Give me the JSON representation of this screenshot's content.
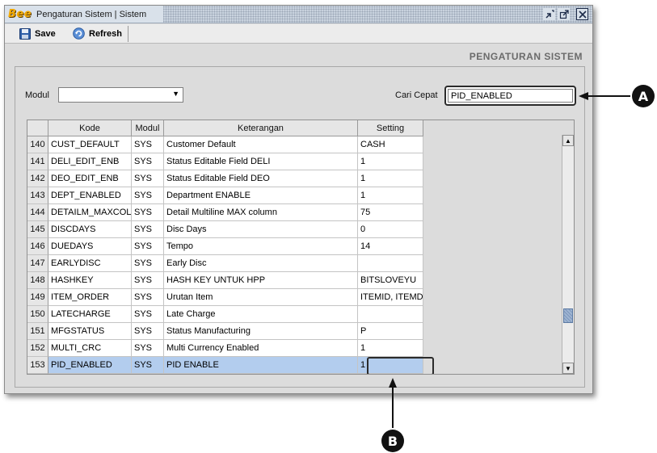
{
  "window": {
    "logo": "Bee",
    "title": "Pengaturan Sistem | Sistem"
  },
  "toolbar": {
    "save_label": "Save",
    "refresh_label": "Refresh"
  },
  "page_title": "PENGATURAN SISTEM",
  "filters": {
    "modul_label": "Modul",
    "modul_value": "",
    "search_label": "Cari Cepat",
    "search_value": "PID_ENABLED"
  },
  "grid": {
    "columns": [
      "Kode",
      "Modul",
      "Keterangan",
      "Setting"
    ],
    "rows": [
      {
        "no": "140",
        "kode": "CUST_DEFAULT",
        "modul": "SYS",
        "ket": "Customer Default",
        "set": "CASH"
      },
      {
        "no": "141",
        "kode": "DELI_EDIT_ENB",
        "modul": "SYS",
        "ket": "Status Editable Field DELI",
        "set": "1"
      },
      {
        "no": "142",
        "kode": "DEO_EDIT_ENB",
        "modul": "SYS",
        "ket": "Status Editable Field DEO",
        "set": "1"
      },
      {
        "no": "143",
        "kode": "DEPT_ENABLED",
        "modul": "SYS",
        "ket": "Department ENABLE",
        "set": "1"
      },
      {
        "no": "144",
        "kode": "DETAILM_MAXCOL",
        "modul": "SYS",
        "ket": "Detail Multiline MAX column",
        "set": "75"
      },
      {
        "no": "145",
        "kode": "DISCDAYS",
        "modul": "SYS",
        "ket": "Disc Days",
        "set": "0"
      },
      {
        "no": "146",
        "kode": "DUEDAYS",
        "modul": "SYS",
        "ket": "Tempo",
        "set": "14"
      },
      {
        "no": "147",
        "kode": "EARLYDISC",
        "modul": "SYS",
        "ket": "Early Disc",
        "set": ""
      },
      {
        "no": "148",
        "kode": "HASHKEY",
        "modul": "SYS",
        "ket": "HASH KEY UNTUK HPP",
        "set": "BITSLOVEYU"
      },
      {
        "no": "149",
        "kode": "ITEM_ORDER",
        "modul": "SYS",
        "ket": "Urutan Item",
        "set": "ITEMID, ITEMDES"
      },
      {
        "no": "150",
        "kode": "LATECHARGE",
        "modul": "SYS",
        "ket": "Late Charge",
        "set": ""
      },
      {
        "no": "151",
        "kode": "MFGSTATUS",
        "modul": "SYS",
        "ket": "Status Manufacturing",
        "set": "P"
      },
      {
        "no": "152",
        "kode": "MULTI_CRC",
        "modul": "SYS",
        "ket": "Multi Currency Enabled",
        "set": "1"
      },
      {
        "no": "153",
        "kode": "PID_ENABLED",
        "modul": "SYS",
        "ket": "PID ENABLE",
        "set": "1",
        "selected": true
      }
    ]
  },
  "callouts": {
    "a": "A",
    "b": "B"
  },
  "colors": {
    "selected_row": "#b3cdee",
    "logo": "#f2a900"
  }
}
